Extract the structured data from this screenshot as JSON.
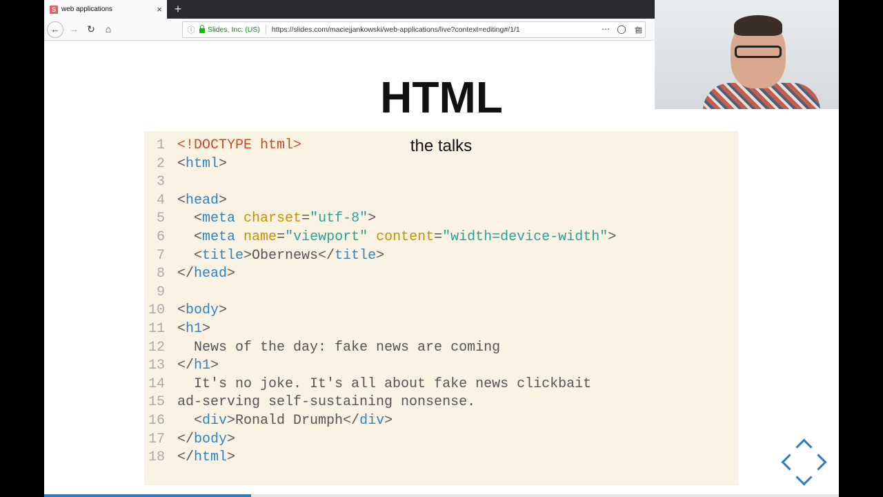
{
  "browser": {
    "tab_title": "web applications",
    "tab_favicon_letter": "S",
    "new_tab_symbol": "+",
    "close_symbol": "×",
    "site_identity": "Slides, Inc. (US)",
    "url": "https://slides.com/maciejjankowski/web-applications/live?context=editing#/1/1"
  },
  "slide": {
    "title": "HTML",
    "overlay_text": "the talks",
    "progress_fraction": 0.26
  },
  "code": {
    "lines": [
      {
        "n": "1",
        "tokens": [
          {
            "t": "<!DOCTYPE html>",
            "c": "doc"
          }
        ]
      },
      {
        "n": "2",
        "tokens": [
          {
            "t": "<",
            "c": "punct"
          },
          {
            "t": "html",
            "c": "tag"
          },
          {
            "t": ">",
            "c": "punct"
          }
        ]
      },
      {
        "n": "3",
        "tokens": []
      },
      {
        "n": "4",
        "tokens": [
          {
            "t": "<",
            "c": "punct"
          },
          {
            "t": "head",
            "c": "tag"
          },
          {
            "t": ">",
            "c": "punct"
          }
        ]
      },
      {
        "n": "5",
        "tokens": [
          {
            "t": "  <",
            "c": "punct"
          },
          {
            "t": "meta",
            "c": "tag"
          },
          {
            "t": " ",
            "c": "punct"
          },
          {
            "t": "charset",
            "c": "attr"
          },
          {
            "t": "=",
            "c": "punct"
          },
          {
            "t": "\"utf-8\"",
            "c": "str"
          },
          {
            "t": ">",
            "c": "punct"
          }
        ]
      },
      {
        "n": "6",
        "tokens": [
          {
            "t": "  <",
            "c": "punct"
          },
          {
            "t": "meta",
            "c": "tag"
          },
          {
            "t": " ",
            "c": "punct"
          },
          {
            "t": "name",
            "c": "attr"
          },
          {
            "t": "=",
            "c": "punct"
          },
          {
            "t": "\"viewport\"",
            "c": "str"
          },
          {
            "t": " ",
            "c": "punct"
          },
          {
            "t": "content",
            "c": "attr"
          },
          {
            "t": "=",
            "c": "punct"
          },
          {
            "t": "\"width=device-width\"",
            "c": "str"
          },
          {
            "t": ">",
            "c": "punct"
          }
        ]
      },
      {
        "n": "7",
        "tokens": [
          {
            "t": "  <",
            "c": "punct"
          },
          {
            "t": "title",
            "c": "tag"
          },
          {
            "t": ">Obernews</",
            "c": "punct"
          },
          {
            "t": "title",
            "c": "tag"
          },
          {
            "t": ">",
            "c": "punct"
          }
        ]
      },
      {
        "n": "8",
        "tokens": [
          {
            "t": "</",
            "c": "punct"
          },
          {
            "t": "head",
            "c": "tag"
          },
          {
            "t": ">",
            "c": "punct"
          }
        ]
      },
      {
        "n": "9",
        "tokens": []
      },
      {
        "n": "10",
        "tokens": [
          {
            "t": "<",
            "c": "punct"
          },
          {
            "t": "body",
            "c": "tag"
          },
          {
            "t": ">",
            "c": "punct"
          }
        ]
      },
      {
        "n": "11",
        "tokens": [
          {
            "t": "<",
            "c": "punct"
          },
          {
            "t": "h1",
            "c": "tag"
          },
          {
            "t": ">",
            "c": "punct"
          }
        ]
      },
      {
        "n": "12",
        "tokens": [
          {
            "t": "  News of the day: fake news are coming",
            "c": "punct"
          }
        ]
      },
      {
        "n": "13",
        "tokens": [
          {
            "t": "</",
            "c": "punct"
          },
          {
            "t": "h1",
            "c": "tag"
          },
          {
            "t": ">",
            "c": "punct"
          }
        ]
      },
      {
        "n": "14",
        "tokens": [
          {
            "t": "  It's no joke. It's all about fake news clickbait",
            "c": "punct"
          }
        ]
      },
      {
        "n": "15",
        "tokens": [
          {
            "t": "ad-serving self-sustaining nonsense.",
            "c": "punct"
          }
        ]
      },
      {
        "n": "16",
        "tokens": [
          {
            "t": "  <",
            "c": "punct"
          },
          {
            "t": "div",
            "c": "tag"
          },
          {
            "t": ">Ronald Drumph</",
            "c": "punct"
          },
          {
            "t": "div",
            "c": "tag"
          },
          {
            "t": ">",
            "c": "punct"
          }
        ]
      },
      {
        "n": "17",
        "tokens": [
          {
            "t": "</",
            "c": "punct"
          },
          {
            "t": "body",
            "c": "tag"
          },
          {
            "t": ">",
            "c": "punct"
          }
        ]
      },
      {
        "n": "18",
        "tokens": [
          {
            "t": "</",
            "c": "punct"
          },
          {
            "t": "html",
            "c": "tag"
          },
          {
            "t": ">",
            "c": "punct"
          }
        ]
      }
    ]
  },
  "colors": {
    "doctype": "#c84b29",
    "tag": "#2b83c5",
    "attr": "#c69100",
    "string": "#2aa198",
    "code_bg": "#faf3e3",
    "accent": "#2b7bc5"
  },
  "icons": {
    "back": "back-arrow-icon",
    "forward": "forward-arrow-icon",
    "reload": "reload-icon",
    "home": "home-icon",
    "info": "info-icon",
    "lock": "lock-icon",
    "reader": "reader-view-icon",
    "more": "more-icon",
    "pocket": "pocket-icon",
    "bookmark": "bookmark-star-icon"
  }
}
